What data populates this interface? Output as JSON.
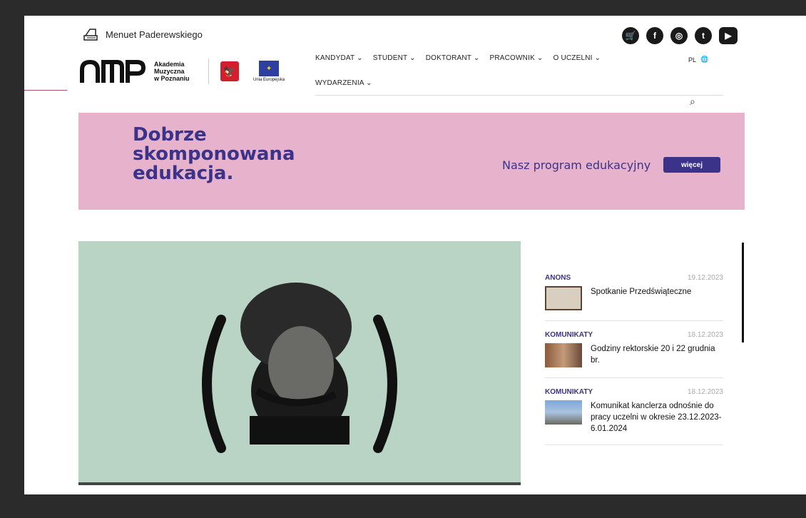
{
  "header": {
    "menuet_label": "Menuet Paderewskiego",
    "akademia_lines": [
      "Akademia",
      "Muzyczna",
      "w Poznaniu"
    ],
    "eu_label": "Unia Europejska"
  },
  "socials": [
    {
      "icon": "shop-icon",
      "glyph": "🛒"
    },
    {
      "icon": "facebook-icon",
      "glyph": "f"
    },
    {
      "icon": "instagram-icon",
      "glyph": "◎"
    },
    {
      "icon": "twitter-icon",
      "glyph": "t"
    },
    {
      "icon": "youtube-icon",
      "glyph": "▶"
    }
  ],
  "nav": {
    "row1": [
      "KANDYDAT ⌄",
      "STUDENT ⌄",
      "DOKTORANT ⌄",
      "PRACOWNIK ⌄",
      "O UCZELNI ⌄"
    ],
    "row2": [
      "WYDARZENIA ⌄"
    ],
    "lang": "PL"
  },
  "banner": {
    "slogan": "Dobrze skomponowana edukacja.",
    "program": "Nasz program edukacyjny",
    "button": "więcej"
  },
  "news": [
    {
      "category": "ANONS",
      "date": "19.12.2023",
      "title": "Spotkanie Przedświąteczne"
    },
    {
      "category": "KOMUNIKATY",
      "date": "18.12.2023",
      "title": "Godziny rektorskie 20 i 22 grudnia br."
    },
    {
      "category": "KOMUNIKATY",
      "date": "18.12.2023",
      "title": "Komunikat kanclerza odnośnie do pracy uczelni w okresie 23.12.2023-6.01.2024"
    }
  ],
  "colors": {
    "accent": "#3a3389",
    "banner": "#e7b3cc",
    "hero": "#b9d3c5"
  }
}
